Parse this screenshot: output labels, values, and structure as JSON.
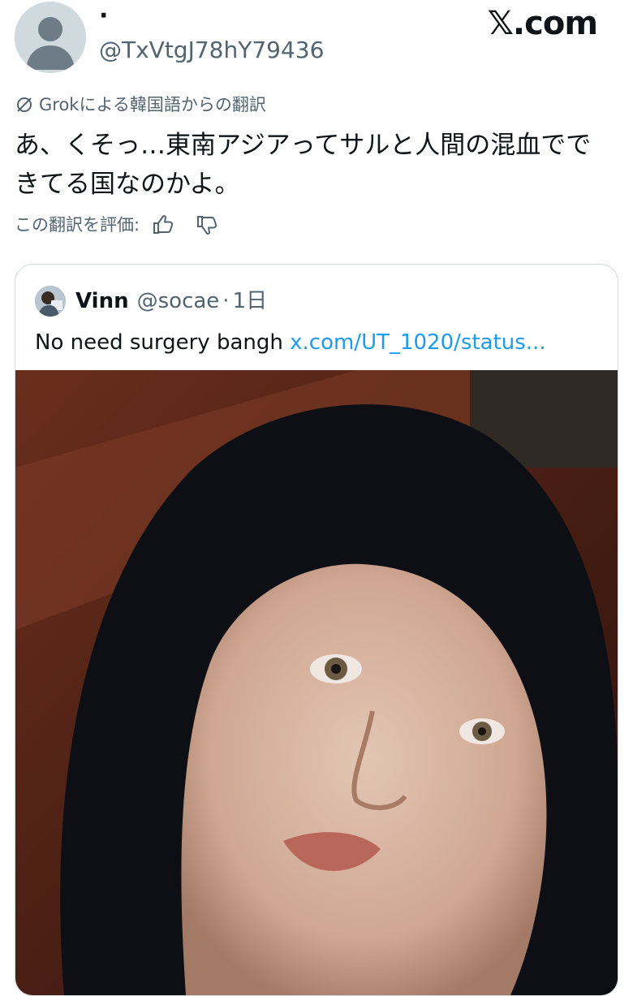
{
  "author": {
    "display_name": "·",
    "handle": "@TxVtgJ78hY79436"
  },
  "brand": "𝕏.com",
  "translation": {
    "label": "Grokによる韓国語からの翻訳",
    "text": "あ、くそっ…東南アジアってサルと人間の混血でできてる国なのかよ。",
    "rate_label": "この翻訳を評価:"
  },
  "quote": {
    "name": "Vinn",
    "handle": "@socae",
    "separator": "·",
    "time": "1日",
    "text": "No need surgery bangh",
    "link": "x.com/UT_1020/status..."
  },
  "icons": {
    "avatar": "default-avatar-icon",
    "translate": "grok-icon",
    "like": "thumbs-up-icon",
    "dislike": "thumbs-down-icon"
  }
}
